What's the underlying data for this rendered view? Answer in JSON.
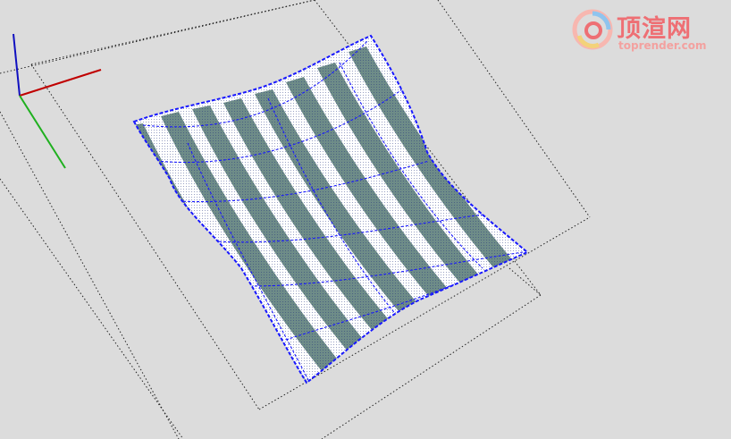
{
  "viewport": {
    "background": "#dcdcdc",
    "axes_colors": {
      "x": "#c00000",
      "y": "#1fb01f",
      "z": "#1010c0"
    }
  },
  "model": {
    "stripe_colors": [
      "#ffffff",
      "#6e8c88"
    ],
    "wire_color": "#1818ff"
  },
  "watermark": {
    "title": "顶渲网",
    "url": "toprender.com",
    "icon": "swirl-logo-icon"
  }
}
